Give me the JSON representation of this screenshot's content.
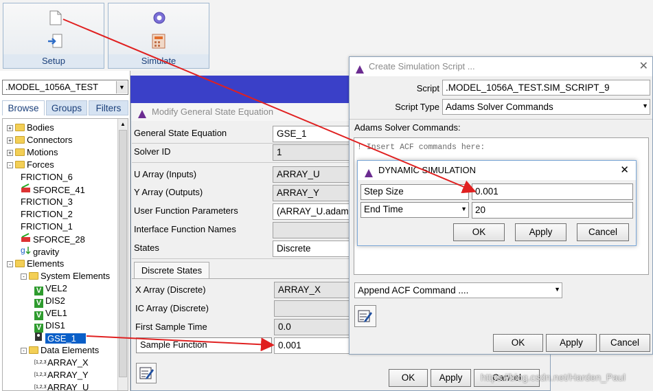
{
  "ribbon": {
    "setup_label": "Setup",
    "simulate_label": "Simulate"
  },
  "browser": {
    "model_select": ".MODEL_1056A_TEST",
    "tabs": [
      "Browse",
      "Groups",
      "Filters"
    ],
    "tree": [
      {
        "label": "Bodies",
        "kind": "folder",
        "level": 0,
        "expander": "+"
      },
      {
        "label": "Connectors",
        "kind": "folder",
        "level": 0,
        "expander": "+"
      },
      {
        "label": "Motions",
        "kind": "folder",
        "level": 0,
        "expander": "+"
      },
      {
        "label": "Forces",
        "kind": "folder",
        "level": 0,
        "expander": "-"
      },
      {
        "label": "FRICTION_6",
        "kind": "friction",
        "level": 1
      },
      {
        "label": "SFORCE_41",
        "kind": "sforce",
        "level": 1
      },
      {
        "label": "FRICTION_3",
        "kind": "friction",
        "level": 1
      },
      {
        "label": "FRICTION_2",
        "kind": "friction",
        "level": 1
      },
      {
        "label": "FRICTION_1",
        "kind": "friction",
        "level": 1
      },
      {
        "label": "SFORCE_28",
        "kind": "sforce",
        "level": 1
      },
      {
        "label": "gravity",
        "kind": "gravity",
        "level": 1
      },
      {
        "label": "Elements",
        "kind": "folder",
        "level": 0,
        "expander": "-"
      },
      {
        "label": "System Elements",
        "kind": "folder",
        "level": 1,
        "expander": "-"
      },
      {
        "label": "VEL2",
        "kind": "var",
        "level": 2
      },
      {
        "label": "DIS2",
        "kind": "var",
        "level": 2
      },
      {
        "label": "VEL1",
        "kind": "var",
        "level": 2
      },
      {
        "label": "DIS1",
        "kind": "var",
        "level": 2
      },
      {
        "label": "GSE_1",
        "kind": "gse",
        "level": 2,
        "selected": true
      },
      {
        "label": "Data Elements",
        "kind": "folder",
        "level": 1,
        "expander": "-"
      },
      {
        "label": "ARRAY_X",
        "kind": "array",
        "level": 2
      },
      {
        "label": "ARRAY_Y",
        "kind": "array",
        "level": 2
      },
      {
        "label": "ARRAY_U",
        "kind": "array",
        "level": 2
      }
    ]
  },
  "gse": {
    "title": "Modify General State Equation",
    "fields": {
      "name_label": "General State Equation",
      "name_value": "GSE_1",
      "solver_label": "Solver ID",
      "solver_value": "1",
      "u_label": "U Array (Inputs)",
      "u_value": "ARRAY_U",
      "y_label": "Y Array (Outputs)",
      "y_value": "ARRAY_Y",
      "ufp_label": "User Function Parameters",
      "ufp_value": "(ARRAY_U.adams",
      "ifn_label": "Interface Function Names",
      "ifn_value": "",
      "states_label": "States",
      "states_value": "Discrete"
    },
    "subtab": "Discrete States",
    "discrete": {
      "x_label": "X Array (Discrete)",
      "x_value": "ARRAY_X",
      "ic_label": "IC Array (Discrete)",
      "ic_value": "",
      "fst_label": "First Sample Time",
      "fst_value": "0.0",
      "sf_select": "Sample Function",
      "sf_value": "0.001"
    },
    "buttons": {
      "ok": "OK",
      "apply": "Apply",
      "cancel": "Cancel"
    }
  },
  "sim_script": {
    "title": "Create Simulation Script ...",
    "script_label": "Script",
    "script_value": ".MODEL_1056A_TEST.SIM_SCRIPT_9",
    "type_label": "Script Type",
    "type_value": "Adams Solver Commands",
    "commands_label": "Adams Solver Commands:",
    "commands_text": "! Insert ACF commands here:",
    "append_select": "Append ACF Command ....",
    "buttons": {
      "ok": "OK",
      "apply": "Apply",
      "cancel": "Cancel"
    }
  },
  "dynamic": {
    "title": "DYNAMIC SIMULATION",
    "row1_select": "Step Size",
    "row1_value": "0.001",
    "row2_select": "End Time",
    "row2_value": "20",
    "buttons": {
      "ok": "OK",
      "apply": "Apply",
      "cancel": "Cancel"
    }
  },
  "watermark": "https://blog.csdn.net/Harden_Paul",
  "colors": {
    "annotation_arrow": "#e02020",
    "gse_titlebar": "#3a40c8",
    "selected_row": "#0a5fc8"
  }
}
